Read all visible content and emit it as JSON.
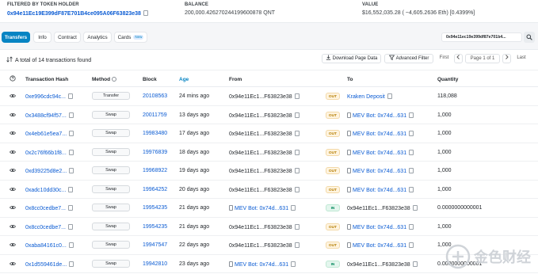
{
  "header": {
    "filtered_label": "FILTERED BY TOKEN HOLDER",
    "filtered_value": "0x94e11Ec19E399dF87E701B4ce095A06F63823e38",
    "balance_label": "BALANCE",
    "balance_value": "200,000.426270244199600878 QNT",
    "value_label": "VALUE",
    "value_value": "$16,552,035.28 ( ~4,605.2636 Eth) [0.4399%]"
  },
  "tabs": [
    {
      "label": "Transfers",
      "active": true
    },
    {
      "label": "Info"
    },
    {
      "label": "Contract"
    },
    {
      "label": "Analytics"
    },
    {
      "label": "Cards",
      "badge": "New"
    }
  ],
  "address_filter": "0x94e11ec19e399df87e701b4...",
  "toolbar": {
    "summary": "A total of 14 transactions found",
    "download": "Download Page Data",
    "advanced_filter": "Advanced Filter",
    "first": "First",
    "page": "Page 1 of 1",
    "last": "Last"
  },
  "columns": {
    "hash": "Transaction Hash",
    "method": "Method",
    "block": "Block",
    "age": "Age",
    "from": "From",
    "to": "To",
    "quantity": "Quantity"
  },
  "rows": [
    {
      "hash": "0xe996cdc94c...",
      "method": "Transfer",
      "block": "20108563",
      "age": "24 mins ago",
      "from": "0x94e11Ec1...F63823e38",
      "dir": "OUT",
      "to": "Kraken Deposit",
      "to_contract": false,
      "to_link": true,
      "qty": "118,088"
    },
    {
      "hash": "0x3488cf94f57...",
      "method": "Swap",
      "block": "20011759",
      "age": "13 days ago",
      "from": "0x94e11Ec1...F63823e38",
      "dir": "OUT",
      "to": "MEV Bot: 0x74d...631",
      "to_contract": true,
      "to_link": true,
      "qty": "1,000"
    },
    {
      "hash": "0x4eb61e5ea7...",
      "method": "Swap",
      "block": "19983480",
      "age": "17 days ago",
      "from": "0x94e11Ec1...F63823e38",
      "dir": "OUT",
      "to": "MEV Bot: 0x74d...631",
      "to_contract": true,
      "to_link": true,
      "qty": "1,000"
    },
    {
      "hash": "0x2c76f66b1f8...",
      "method": "Swap",
      "block": "19976839",
      "age": "18 days ago",
      "from": "0x94e11Ec1...F63823e38",
      "dir": "OUT",
      "to": "MEV Bot: 0x74d...631",
      "to_contract": true,
      "to_link": true,
      "qty": "1,000"
    },
    {
      "hash": "0xd39225d8e2...",
      "method": "Swap",
      "block": "19968922",
      "age": "19 days ago",
      "from": "0x94e11Ec1...F63823e38",
      "dir": "OUT",
      "to": "MEV Bot: 0x74d...631",
      "to_contract": true,
      "to_link": true,
      "qty": "1,000"
    },
    {
      "hash": "0xadc10dd30c...",
      "method": "Swap",
      "block": "19964252",
      "age": "20 days ago",
      "from": "0x94e11Ec1...F63823e38",
      "dir": "OUT",
      "to": "MEV Bot: 0x74d...631",
      "to_contract": true,
      "to_link": true,
      "qty": "1,000"
    },
    {
      "hash": "0x8cc0cedbe7...",
      "method": "Swap",
      "block": "19954235",
      "age": "21 days ago",
      "from": "MEV Bot: 0x74d...631",
      "from_contract": true,
      "from_link": true,
      "dir": "IN",
      "to": "0x94e11Ec1...F63823e38",
      "to_contract": false,
      "to_link": false,
      "qty": "0.0000000000001"
    },
    {
      "hash": "0x8cc0cedbe7...",
      "method": "Swap",
      "block": "19954235",
      "age": "21 days ago",
      "from": "0x94e11Ec1...F63823e38",
      "dir": "OUT",
      "to": "MEV Bot: 0x74d...631",
      "to_contract": true,
      "to_link": true,
      "qty": "1,000"
    },
    {
      "hash": "0xaba84161c0...",
      "method": "Swap",
      "block": "19947547",
      "age": "22 days ago",
      "from": "0x94e11Ec1...F63823e38",
      "dir": "OUT",
      "to": "MEV Bot: 0x74d...631",
      "to_contract": true,
      "to_link": true,
      "qty": "1,000"
    },
    {
      "hash": "0x1d559461de...",
      "method": "Swap",
      "block": "19942810",
      "age": "23 days ago",
      "from": "MEV Bot: 0x74d...631",
      "from_contract": true,
      "from_link": true,
      "dir": "IN",
      "to": "0x94e11Ec1...F63823e38",
      "to_contract": false,
      "to_link": false,
      "qty": "0.0000000000001"
    }
  ],
  "watermark": "金色财经",
  "colors": {
    "accent": "#0784c3",
    "link": "#0a5bd3",
    "out": "#b47d00",
    "in": "#00875a"
  }
}
